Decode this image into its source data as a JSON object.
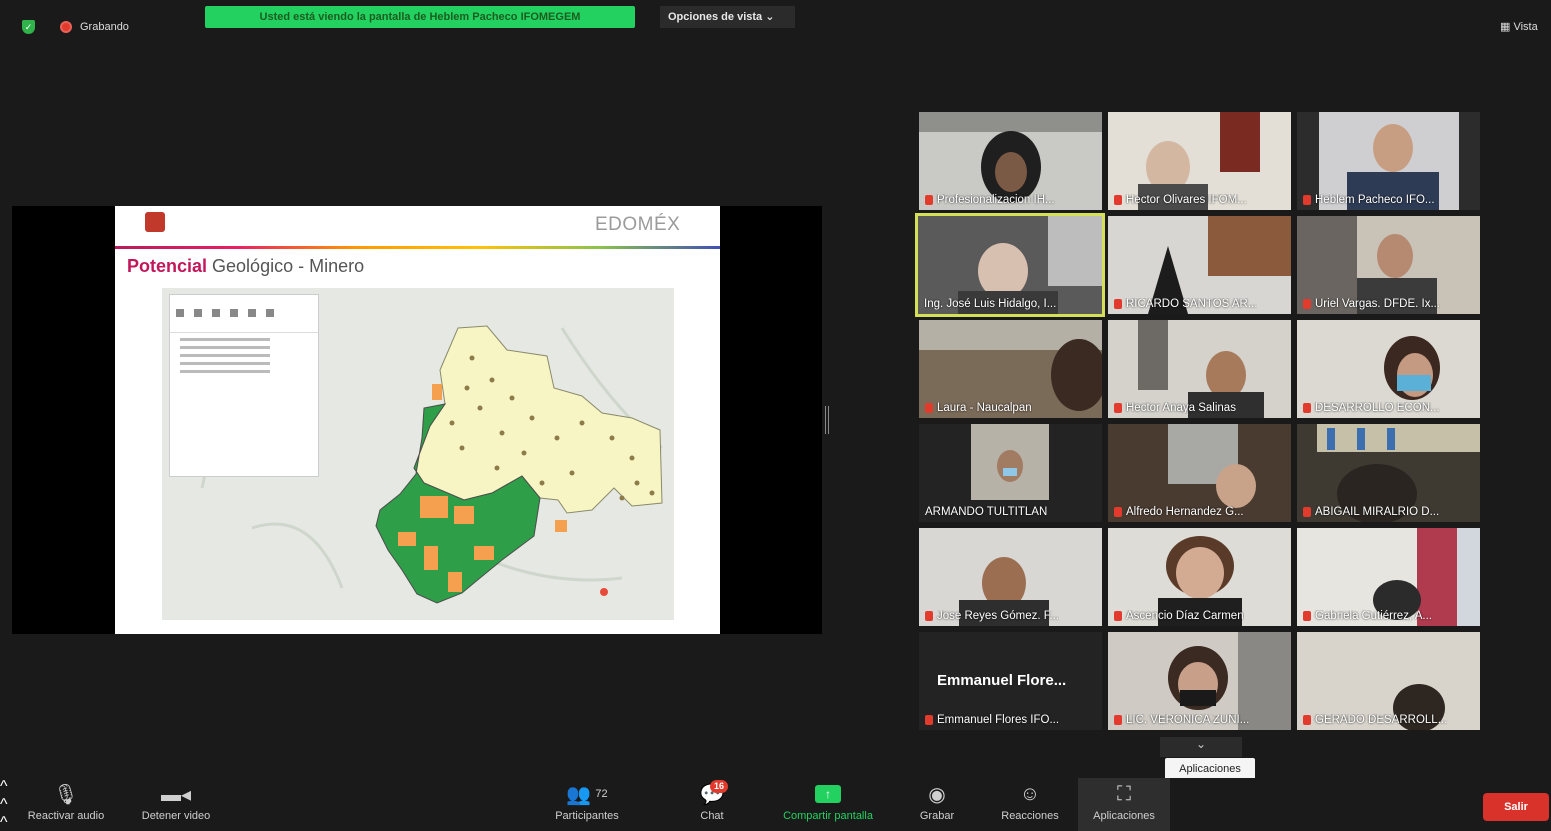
{
  "top_bar": {
    "recording_label": "Grabando",
    "banner_text": "Usted está viendo la pantalla de Heblem Pacheco IFOMEGEM",
    "view_options_label": "Opciones de vista",
    "view_label": "Vista"
  },
  "slide": {
    "brand": "EDOMÉX",
    "title_highlight": "Potencial",
    "title_rest": " Geológico - Minero"
  },
  "participants": [
    {
      "name": "Profesionalizacion IH...",
      "muted": true
    },
    {
      "name": "Hector Olivares IFOM...",
      "muted": true
    },
    {
      "name": "Heblem Pacheco IFO...",
      "muted": true
    },
    {
      "name": "Ing. José Luis Hidalgo, I...",
      "muted": false
    },
    {
      "name": "RICARDO SANTOS AR...",
      "muted": true
    },
    {
      "name": "Uriel Vargas. DFDE. Ix...",
      "muted": true
    },
    {
      "name": "Laura - Naucalpan",
      "muted": true
    },
    {
      "name": "Hector Anaya Salinas",
      "muted": true
    },
    {
      "name": "DESARROLLO ECON...",
      "muted": true
    },
    {
      "name": "ARMANDO TULTITLAN",
      "muted": false
    },
    {
      "name": "Alfredo Hernandez G...",
      "muted": true
    },
    {
      "name": "ABIGAIL MIRALRIO D...",
      "muted": true
    },
    {
      "name": "Jose Reyes Gómez. F...",
      "muted": true
    },
    {
      "name": "Ascencio Díaz Carmen",
      "muted": true
    },
    {
      "name": "Gabriela Gutiérrez, A...",
      "muted": true
    },
    {
      "name": "Emmanuel Flores IFO...",
      "muted": true,
      "display_name": "Emmanuel Flore..."
    },
    {
      "name": "LIC. VERÓNICA ZUÑI...",
      "muted": true
    },
    {
      "name": "GERADO DESARROLL...",
      "muted": true
    }
  ],
  "tooltip": "Aplicaciones",
  "toolbar": {
    "unmute": "Reactivar audio",
    "stop_video": "Detener video",
    "participants": "Participantes",
    "participants_count": "72",
    "chat": "Chat",
    "chat_badge": "16",
    "share_screen": "Compartir pantalla",
    "record": "Grabar",
    "reactions": "Reacciones",
    "apps": "Aplicaciones",
    "leave": "Salir"
  },
  "colors": {
    "green_accent": "#23d160",
    "leave_red": "#d9322a",
    "active_speaker": "#d4e157"
  }
}
